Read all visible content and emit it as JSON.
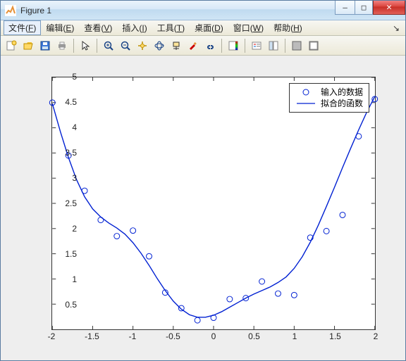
{
  "window": {
    "title": "Figure 1",
    "buttons": {
      "min": "–",
      "max": "□",
      "close": "✕"
    }
  },
  "menubar": {
    "items": [
      {
        "pre": "文件(",
        "mn": "F",
        "post": ")",
        "active": true
      },
      {
        "pre": "编辑(",
        "mn": "E",
        "post": ")"
      },
      {
        "pre": "查看(",
        "mn": "V",
        "post": ")"
      },
      {
        "pre": "插入(",
        "mn": "I",
        "post": ")"
      },
      {
        "pre": "工具(",
        "mn": "T",
        "post": ")"
      },
      {
        "pre": "桌面(",
        "mn": "D",
        "post": ")"
      },
      {
        "pre": "窗口(",
        "mn": "W",
        "post": ")"
      },
      {
        "pre": "帮助(",
        "mn": "H",
        "post": ")"
      }
    ],
    "overflow": "↘"
  },
  "toolbar": {
    "buttons": [
      "new-figure-icon",
      "open-icon",
      "save-icon",
      "print-icon",
      "sep",
      "pointer-icon",
      "sep",
      "zoom-in-icon",
      "zoom-out-icon",
      "pan-icon",
      "rotate3d-icon",
      "datacursor-icon",
      "brush-icon",
      "link-icon",
      "sep",
      "colorbar-icon",
      "sep",
      "legend-icon",
      "layout-icon",
      "sep",
      "hideplot-icon",
      "showplot-icon"
    ]
  },
  "legend": {
    "items": [
      {
        "label": "输入的数据",
        "type": "marker"
      },
      {
        "label": "拟合的函数",
        "type": "line"
      }
    ]
  },
  "colors": {
    "plot": "#0020d2"
  },
  "chart_data": {
    "type": "scatter",
    "xlim": [
      -2,
      2
    ],
    "ylim": [
      0,
      5
    ],
    "xticks": [
      -2,
      -1.5,
      -1,
      -0.5,
      0,
      0.5,
      1,
      1.5,
      2
    ],
    "yticks": [
      0.5,
      1,
      1.5,
      2,
      2.5,
      3,
      3.5,
      4,
      4.5,
      5
    ],
    "title": "",
    "xlabel": "",
    "ylabel": "",
    "grid": false,
    "scatter": {
      "x": [
        -2.0,
        -1.8,
        -1.6,
        -1.4,
        -1.2,
        -1.0,
        -0.8,
        -0.6,
        -0.4,
        -0.2,
        0.0,
        0.2,
        0.4,
        0.6,
        0.8,
        1.0,
        1.2,
        1.4,
        1.6,
        1.8,
        2.0
      ],
      "y": [
        4.5,
        3.45,
        2.75,
        2.17,
        1.85,
        1.96,
        1.45,
        0.73,
        0.42,
        0.18,
        0.23,
        0.6,
        0.62,
        0.95,
        0.71,
        0.68,
        1.82,
        1.95,
        2.27,
        3.83,
        4.57
      ]
    },
    "fit": {
      "x": [
        -2.0,
        -1.9,
        -1.8,
        -1.7,
        -1.6,
        -1.5,
        -1.4,
        -1.3,
        -1.2,
        -1.1,
        -1.0,
        -0.9,
        -0.8,
        -0.7,
        -0.6,
        -0.5,
        -0.4,
        -0.3,
        -0.2,
        -0.1,
        0.0,
        0.1,
        0.2,
        0.3,
        0.4,
        0.5,
        0.6,
        0.7,
        0.8,
        0.9,
        1.0,
        1.1,
        1.2,
        1.3,
        1.4,
        1.5,
        1.6,
        1.7,
        1.8,
        1.9,
        2.0
      ],
      "y": [
        4.48,
        3.92,
        3.41,
        2.97,
        2.63,
        2.39,
        2.23,
        2.11,
        2.01,
        1.89,
        1.72,
        1.51,
        1.27,
        1.01,
        0.77,
        0.56,
        0.4,
        0.29,
        0.24,
        0.24,
        0.28,
        0.35,
        0.44,
        0.53,
        0.62,
        0.7,
        0.77,
        0.84,
        0.93,
        1.04,
        1.21,
        1.44,
        1.73,
        2.07,
        2.44,
        2.82,
        3.21,
        3.59,
        3.96,
        4.31,
        4.62
      ]
    }
  }
}
